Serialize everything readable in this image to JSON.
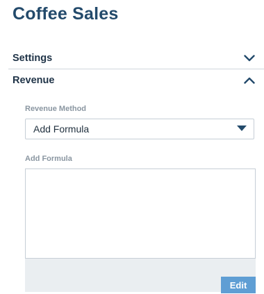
{
  "app": {
    "title": "Coffee Sales"
  },
  "sections": {
    "settings": {
      "label": "Settings",
      "state_icon": "chevron-down-icon"
    },
    "revenue": {
      "label": "Revenue",
      "state_icon": "chevron-up-icon"
    }
  },
  "revenue_method": {
    "label": "Revenue Method",
    "selected": "Add Formula",
    "icon": "caret-down-icon"
  },
  "formula": {
    "label": "Add Formula",
    "value": "",
    "edit_label": "Edit"
  },
  "colors": {
    "title": "#234a6b",
    "accent_button": "#5f9ed4",
    "panel_bg": "#eaeef1"
  }
}
